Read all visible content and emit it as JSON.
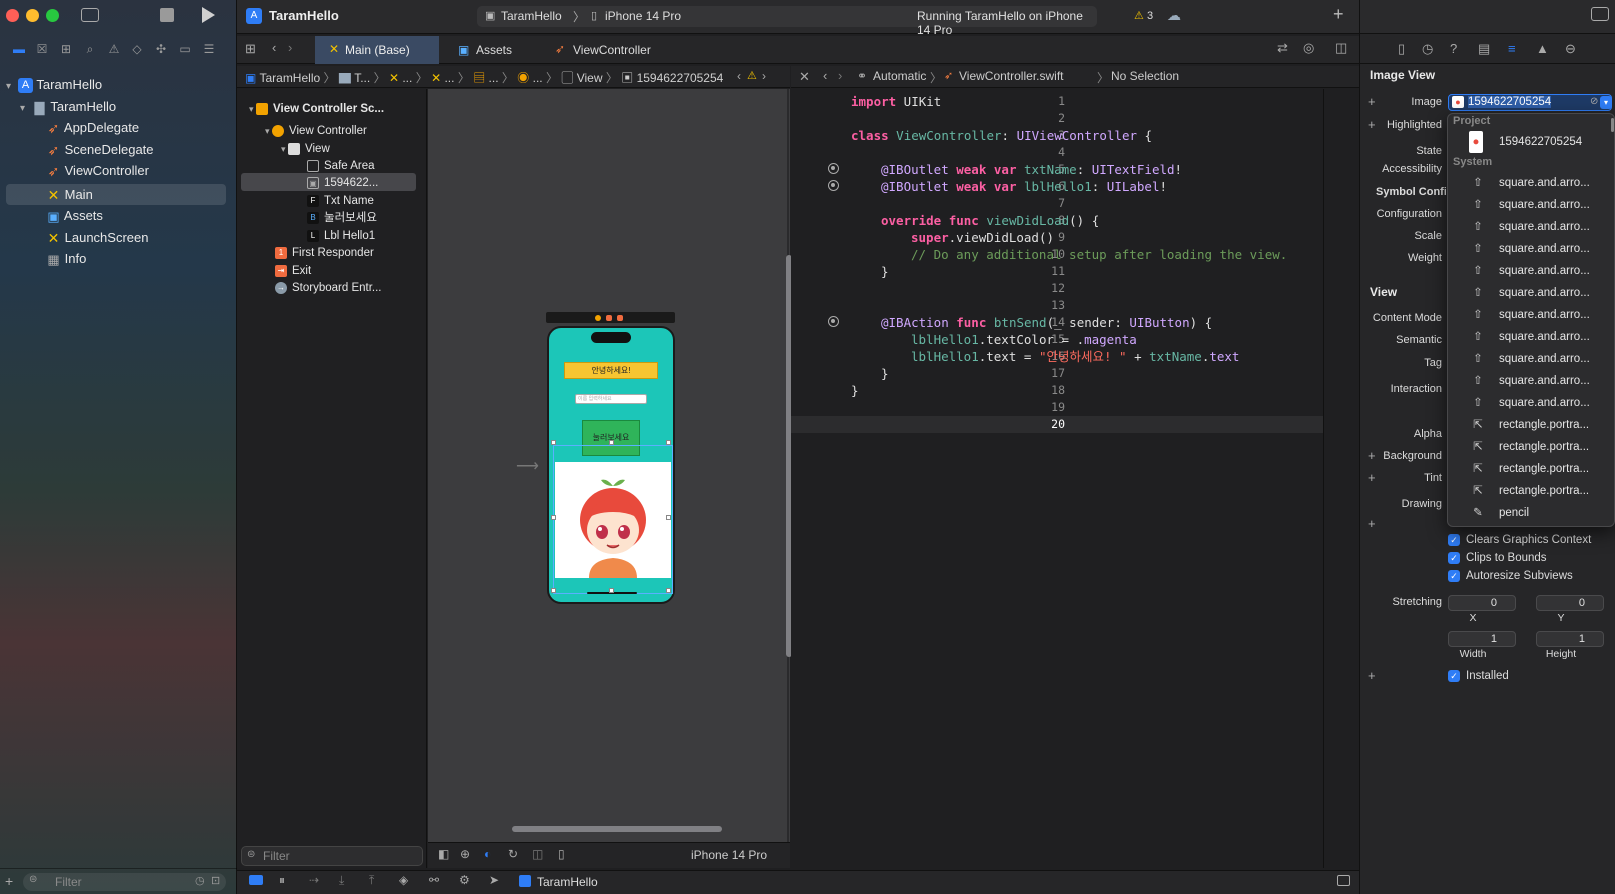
{
  "window": {
    "project_name": "TaramHello"
  },
  "toolbar": {
    "scheme": "TaramHello",
    "device": "iPhone 14 Pro",
    "status": "Running TaramHello on iPhone 14 Pro",
    "warning_count": "3"
  },
  "navigator": {
    "items": [
      {
        "label": "TaramHello",
        "icon": "project-icon"
      },
      {
        "label": "TaramHello",
        "icon": "folder-icon"
      },
      {
        "label": "AppDelegate",
        "icon": "swift-file-icon"
      },
      {
        "label": "SceneDelegate",
        "icon": "swift-file-icon"
      },
      {
        "label": "ViewController",
        "icon": "swift-file-icon"
      },
      {
        "label": "Main",
        "icon": "storyboard-icon"
      },
      {
        "label": "Assets",
        "icon": "asset-catalog-icon"
      },
      {
        "label": "LaunchScreen",
        "icon": "storyboard-icon"
      },
      {
        "label": "Info",
        "icon": "plist-icon"
      }
    ],
    "filter_placeholder": "Filter"
  },
  "tabs": [
    "Main (Base)",
    "Assets",
    "ViewController"
  ],
  "ib_jumpbar": [
    "TaramHello",
    "T...",
    "...",
    "...",
    "...",
    "View",
    "1594622705254"
  ],
  "editor_jumpbar": [
    "Automatic",
    "ViewController.swift",
    "No Selection"
  ],
  "outline": {
    "items": [
      "View Controller Sc...",
      "View Controller",
      "View",
      "Safe Area",
      "1594622...",
      "Txt Name",
      "눌러보세요",
      "Lbl Hello1",
      "First Responder",
      "Exit",
      "Storyboard Entr..."
    ],
    "filter_placeholder": "Filter"
  },
  "canvas": {
    "label_text": "안녕하세요!",
    "textfield_placeholder": "이름 입력하세요",
    "button_text": "눌러보세요",
    "device_label": "iPhone 14 Pro"
  },
  "code": {
    "lines": [
      "1",
      "2",
      "3",
      "4",
      "5",
      "6",
      "7",
      "8",
      "9",
      "10",
      "11",
      "12",
      "13",
      "14",
      "15",
      "16",
      "17",
      "18",
      "19",
      "20"
    ],
    "l1_kw": "import",
    "l1_rest": " UIKit",
    "l3_kw": "class",
    "l3_name": " ViewController",
    "l3_rest": ": ",
    "l3_type": "UIViewController",
    "l3_end": " {",
    "l5_attr": "@IBOutlet",
    "l5_kw": " weak var",
    "l5_name": " txtName",
    "l5_rest": ": ",
    "l5_type": "UITextField",
    "l5_end": "!",
    "l6_attr": "@IBOutlet",
    "l6_kw": " weak var",
    "l6_name": " lblHello1",
    "l6_rest": ": ",
    "l6_type": "UILabel",
    "l6_end": "!",
    "l8_kw": "override func",
    "l8_name": " viewDidLoad",
    "l8_end": "() {",
    "l9_kw": "super",
    "l9_rest": ".viewDidLoad()",
    "l10_comment": "// Do any additional setup after loading the view.",
    "l11": "}",
    "l14_attr": "@IBAction",
    "l14_kw": " func",
    "l14_name": " btnSend",
    "l14_rest": "(_ sender: ",
    "l14_type": "UIButton",
    "l14_end": ") {",
    "l15_a": "lblHello1",
    "l15_b": ".textColor = .",
    "l15_c": "magenta",
    "l16_a": "lblHello1",
    "l16_b": ".text = ",
    "l16_str": "\"안녕하세요! \"",
    "l16_c": " + ",
    "l16_d": "txtName",
    "l16_e": ".",
    "l16_f": "text",
    "l17": "}",
    "l18": "}"
  },
  "inspector": {
    "section_image_view": "Image View",
    "image_label": "Image",
    "image_value": "1594622705254",
    "highlighted_label": "Highlighted",
    "state_label": "State",
    "accessibility_label": "Accessibility",
    "symbol_config_label": "Symbol Config",
    "configuration_label": "Configuration",
    "scale_label": "Scale",
    "weight_label": "Weight",
    "section_view": "View",
    "content_mode_label": "Content Mode",
    "semantic_label": "Semantic",
    "tag_label": "Tag",
    "interaction_label": "Interaction",
    "alpha_label": "Alpha",
    "background_label": "Background",
    "tint_label": "Tint",
    "drawing_label": "Drawing",
    "clears_graphics": "Clears Graphics Context",
    "clips_to_bounds": "Clips to Bounds",
    "autoresize": "Autoresize Subviews",
    "stretching_label": "Stretching",
    "stretch_x": "0",
    "stretch_y": "0",
    "stretch_w": "1",
    "stretch_h": "1",
    "x_label": "X",
    "y_label": "Y",
    "width_label": "Width",
    "height_label": "Height",
    "installed": "Installed"
  },
  "dropdown": {
    "project_header": "Project",
    "project_item": "1594622705254",
    "system_header": "System",
    "items": [
      "square.and.arro...",
      "square.and.arro...",
      "square.and.arro...",
      "square.and.arro...",
      "square.and.arro...",
      "square.and.arro...",
      "square.and.arro...",
      "square.and.arro...",
      "square.and.arro...",
      "square.and.arro...",
      "square.and.arro...",
      "rectangle.portra...",
      "rectangle.portra...",
      "rectangle.portra...",
      "rectangle.portra...",
      "pencil"
    ]
  },
  "debug_bar": {
    "target": "TaramHello"
  },
  "colors": {
    "accent": "#2f7df6",
    "device_bg": "#1cc6b8",
    "label_bg": "#f7c531",
    "button_bg": "#2fb45a"
  }
}
